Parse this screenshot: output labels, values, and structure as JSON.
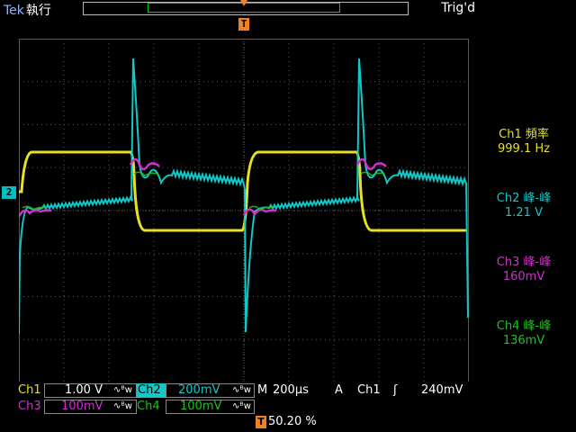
{
  "header": {
    "brand": "Tek",
    "run_status": "執行",
    "trigger_status": "Trig'd",
    "trigger_marker": "T"
  },
  "channel2_marker": "2",
  "measurements": [
    {
      "label": "Ch1 頻率",
      "value": "999.1 Hz",
      "color": "#e8e020"
    },
    {
      "label": "Ch2 峰-峰",
      "value": "1.21 V",
      "color": "#10c8c8"
    },
    {
      "label": "Ch3 峰-峰",
      "value": "160mV",
      "color": "#d030d0"
    },
    {
      "label": "Ch4 峰-峰",
      "value": "136mV",
      "color": "#20c020"
    }
  ],
  "bottom": {
    "ch1_label": "Ch1",
    "ch1_scale": "1.00 V",
    "ch2_label": "Ch2",
    "ch2_scale": "200mV",
    "ch3_label": "Ch3",
    "ch3_scale": "100mV",
    "ch4_label": "Ch4",
    "ch4_scale": "100mV",
    "coupling": "∿ᴮw",
    "timebase_label": "M",
    "timebase_value": "200µs",
    "trigger_label": "A",
    "trigger_source": "Ch1",
    "trigger_slope": "ʃ",
    "trigger_level": "240mV",
    "position_percent": "50.20 %",
    "position_marker": "T"
  },
  "colors": {
    "ch1": "#e8e020",
    "ch2": "#10c8c8",
    "ch3": "#d030d0",
    "ch4": "#20c020",
    "grid": "#5a5a5a",
    "trigger": "#f08020"
  }
}
